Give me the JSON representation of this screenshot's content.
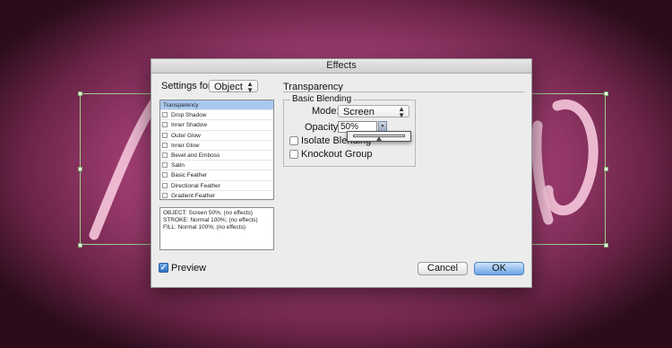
{
  "dialog": {
    "title": "Effects"
  },
  "settings_for": {
    "label": "Settings for:",
    "value": "Object"
  },
  "effects_list": [
    {
      "label": "Transparency",
      "selected": true,
      "checkbox": false
    },
    {
      "label": "Drop Shadow",
      "checkbox": true
    },
    {
      "label": "Inner Shadow",
      "checkbox": true
    },
    {
      "label": "Outer Glow",
      "checkbox": true
    },
    {
      "label": "Inner Glow",
      "checkbox": true
    },
    {
      "label": "Bevel and Emboss",
      "checkbox": true
    },
    {
      "label": "Satin",
      "checkbox": true
    },
    {
      "label": "Basic Feather",
      "checkbox": true
    },
    {
      "label": "Directional Feather",
      "checkbox": true
    },
    {
      "label": "Gradient Feather",
      "checkbox": true
    }
  ],
  "summary": [
    "OBJECT: Screen 50%; (no effects)",
    "STROKE: Normal 100%; (no effects)",
    "FILL: Normal 100%; (no effects)"
  ],
  "panel": {
    "title": "Transparency",
    "group_title": "Basic Blending",
    "mode_label": "Mode:",
    "mode_value": "Screen",
    "opacity_label": "Opacity:",
    "opacity_value": "50%",
    "opacity_level": 0.5,
    "isolate_label": "Isolate Blending",
    "knockout_label": "Knockout Group"
  },
  "preview": {
    "label": "Preview",
    "checked": true
  },
  "buttons": {
    "cancel": "Cancel",
    "ok": "OK"
  },
  "colors": {
    "background": "#b54882",
    "accent": "#3b82d6",
    "selection": "#9fcf8e"
  }
}
